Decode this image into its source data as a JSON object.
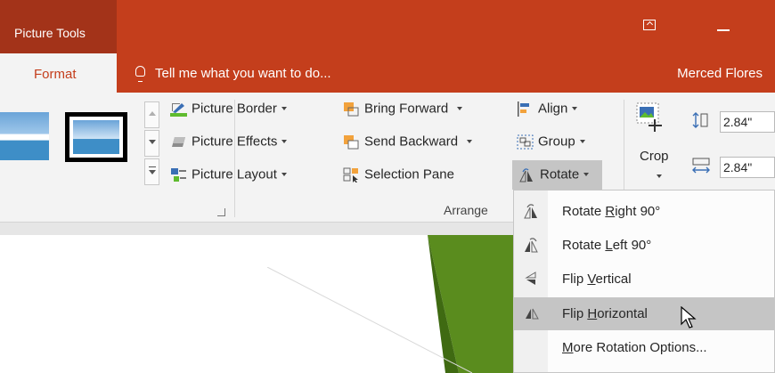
{
  "titlebar": {
    "context_tab": "Picture Tools"
  },
  "tabs": {
    "active": "Format",
    "tell_me": "Tell me what you want to do...",
    "user": "Merced Flores"
  },
  "picture_styles_group": {
    "picture_border": "Picture Border",
    "picture_effects": "Picture Effects",
    "picture_layout": "Picture Layout"
  },
  "arrange_group": {
    "label": "Arrange",
    "bring_forward": "Bring Forward",
    "send_backward": "Send Backward",
    "selection_pane": "Selection Pane",
    "align": "Align",
    "group": "Group",
    "rotate": "Rotate"
  },
  "size_group": {
    "crop": "Crop",
    "height": "2.84\"",
    "width": "2.84\""
  },
  "rotate_menu": {
    "items": [
      {
        "pre": "Rotate ",
        "key": "R",
        "post": "ight 90°"
      },
      {
        "pre": "Rotate ",
        "key": "L",
        "post": "eft 90°"
      },
      {
        "pre": "Flip ",
        "key": "V",
        "post": "ertical"
      },
      {
        "pre": "Flip ",
        "key": "H",
        "post": "orizontal"
      },
      {
        "pre": "",
        "key": "M",
        "post": "ore Rotation Options..."
      }
    ],
    "highlighted_index": 3
  },
  "colors": {
    "accent": "#c43e1c",
    "accent_dark": "#a33319",
    "slide_green": "#5a8c1e"
  }
}
